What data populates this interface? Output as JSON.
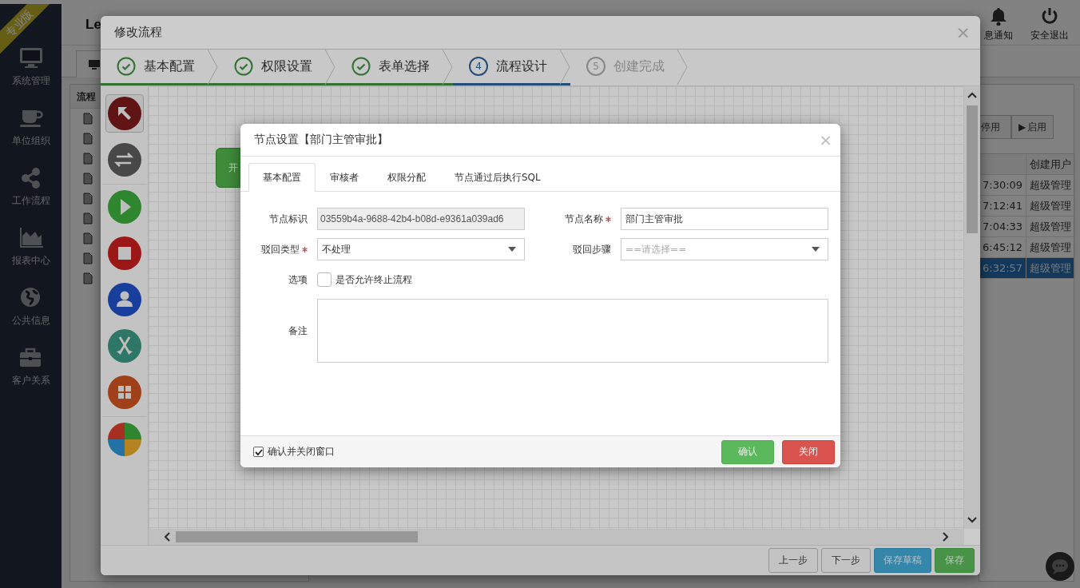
{
  "sidebar": {
    "badge": "专业版",
    "items": [
      {
        "label": "系统管理",
        "kind": "monitor"
      },
      {
        "label": "单位组织",
        "kind": "cup"
      },
      {
        "label": "工作流程",
        "kind": "share"
      },
      {
        "label": "报表中心",
        "kind": "chart"
      },
      {
        "label": "公共信息",
        "kind": "globe"
      },
      {
        "label": "客户关系",
        "kind": "briefcase"
      }
    ]
  },
  "header": {
    "title": "Le",
    "actions": [
      {
        "label": "息通知",
        "kind": "bell"
      },
      {
        "label": "安全退出",
        "kind": "power"
      }
    ]
  },
  "list_panel": {
    "title": "流程",
    "items": [
      {
        "kind": "file"
      },
      {
        "kind": "file"
      },
      {
        "kind": "file"
      },
      {
        "kind": "file"
      },
      {
        "kind": "file"
      },
      {
        "kind": "file"
      },
      {
        "kind": "file"
      },
      {
        "kind": "file"
      },
      {
        "kind": "file"
      }
    ]
  },
  "right_panel": {
    "buttons": [
      {
        "label": "停用"
      },
      {
        "icon": "▶",
        "label": "启用"
      }
    ],
    "table": {
      "columns": [
        {},
        {
          "label": "创建用户"
        }
      ],
      "rows": [
        {
          "time": "7:30:09",
          "user": "超级管理",
          "selected": false
        },
        {
          "time": "7:12:41",
          "user": "超级管理",
          "selected": false
        },
        {
          "time": "7:04:33",
          "user": "超级管理",
          "selected": false
        },
        {
          "time": "6:45:12",
          "user": "超级管理",
          "selected": false
        },
        {
          "time": "6:32:57",
          "user": "超级管理",
          "selected": true
        }
      ]
    }
  },
  "flow_modal": {
    "title": "修改流程",
    "close": "×",
    "steps": [
      {
        "label": "基本配置",
        "kind": "done"
      },
      {
        "label": "权限设置",
        "kind": "done"
      },
      {
        "label": "表单选择",
        "kind": "done"
      },
      {
        "number": "4",
        "label": "流程设计",
        "kind": "current"
      },
      {
        "number": "5",
        "label": "创建完成",
        "kind": "pending"
      }
    ],
    "tool_groups": [
      [
        {
          "kind": "pointer",
          "selected": true
        },
        {
          "kind": "connector",
          "selected": false
        }
      ],
      [
        {
          "kind": "start",
          "selected": false
        },
        {
          "kind": "end",
          "selected": false
        },
        {
          "kind": "user",
          "selected": false
        },
        {
          "kind": "fork",
          "selected": false
        },
        {
          "kind": "join",
          "selected": false
        }
      ],
      [
        {
          "kind": "quad",
          "selected": false
        }
      ]
    ],
    "nodes": [
      {
        "label": "开",
        "kind": "start"
      }
    ],
    "buttons": [
      {
        "label": "上一步",
        "kind": "default"
      },
      {
        "label": "下一步",
        "kind": "default"
      },
      {
        "label": "保存草稿",
        "kind": "info"
      },
      {
        "label": "保存",
        "kind": "success"
      }
    ]
  },
  "node_dialog": {
    "title": "节点设置【部门主管审批】",
    "close": "×",
    "tabs": [
      {
        "label": "基本配置",
        "selected": true
      },
      {
        "label": "审核者",
        "selected": false
      },
      {
        "label": "权限分配",
        "selected": false
      },
      {
        "label": "节点通过后执行SQL",
        "selected": false
      }
    ],
    "fields": [
      {
        "kind": "text",
        "label": "节点标识",
        "value": "03559b4a-9688-42b4-b08d-e9361a039ad6",
        "readonly": true,
        "required": false
      },
      {
        "kind": "text",
        "label": "节点名称",
        "value": "部门主管审批",
        "readonly": false,
        "required": true
      },
      {
        "kind": "select",
        "label": "驳回类型",
        "value": "不处理",
        "required": true
      },
      {
        "kind": "select",
        "label": "驳回步骤",
        "placeholder": "==请选择==",
        "required": false
      },
      {
        "kind": "checkbox",
        "label": "选项",
        "text": "是否允许终止流程",
        "checked": false
      },
      {
        "kind": "textarea",
        "label": "备注"
      }
    ],
    "footer": {
      "checkbox": {
        "label": "确认并关闭窗口",
        "checked": true
      },
      "buttons": [
        {
          "label": "确认",
          "kind": "success"
        },
        {
          "label": "关闭",
          "kind": "danger"
        }
      ]
    }
  }
}
